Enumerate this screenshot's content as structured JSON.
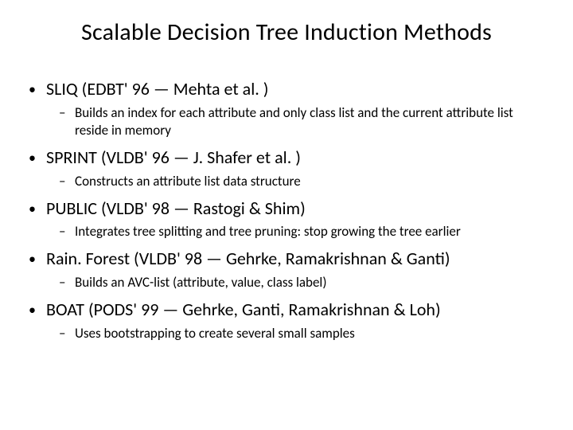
{
  "title": "Scalable Decision Tree Induction Methods",
  "items": [
    {
      "label": "SLIQ (EDBT' 96 — Mehta et al. )",
      "sub": "Builds an index for each attribute and only class list and the current attribute list reside in memory"
    },
    {
      "label": "SPRINT (VLDB' 96 — J. Shafer et al. )",
      "sub": "Constructs an attribute list data structure"
    },
    {
      "label": "PUBLIC (VLDB' 98 — Rastogi & Shim)",
      "sub": "Integrates tree splitting and tree pruning: stop growing the tree earlier"
    },
    {
      "label": "Rain. Forest (VLDB' 98 — Gehrke, Ramakrishnan & Ganti)",
      "sub": "Builds an AVC-list (attribute, value, class label)"
    },
    {
      "label": "BOAT (PODS' 99 — Gehrke, Ganti, Ramakrishnan & Loh)",
      "sub": "Uses bootstrapping to create several small samples"
    }
  ]
}
